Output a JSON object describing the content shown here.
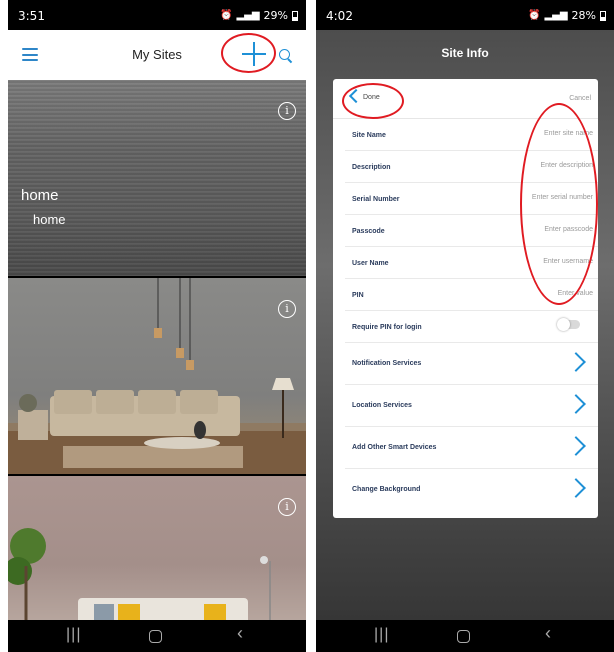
{
  "left": {
    "status": {
      "time": "3:51",
      "battery": "29%"
    },
    "app_bar": {
      "title": "My Sites"
    },
    "sites": [
      {
        "name": "home",
        "description": "home"
      },
      {
        "name": "",
        "description": ""
      },
      {
        "name": "",
        "description": ""
      }
    ],
    "info_glyph": "i"
  },
  "right": {
    "status": {
      "time": "4:02",
      "battery": "28%"
    },
    "screen_title": "Site Info",
    "done_label": "Done",
    "cancel_label": "Cancel",
    "fields": [
      {
        "label": "Site Name",
        "placeholder": "Enter site name"
      },
      {
        "label": "Description",
        "placeholder": "Enter description"
      },
      {
        "label": "Serial Number",
        "placeholder": "Enter serial number"
      },
      {
        "label": "Passcode",
        "placeholder": "Enter passcode"
      },
      {
        "label": "User Name",
        "placeholder": "Enter username"
      },
      {
        "label": "PIN",
        "placeholder": "Enter value"
      }
    ],
    "require_pin": {
      "label": "Require PIN for login",
      "enabled": false
    },
    "menu": [
      {
        "label": "Notification Services"
      },
      {
        "label": "Location Services"
      },
      {
        "label": "Add Other Smart Devices"
      },
      {
        "label": "Change Background"
      }
    ]
  },
  "system_icons": {
    "left_status": [
      "alarm-icon",
      "signal-icon",
      "battery-icon"
    ],
    "nav": [
      "recent-apps-icon",
      "home-icon",
      "back-icon"
    ]
  },
  "colors": {
    "accent": "#1e90d6",
    "annotation": "#e01b22",
    "label_text": "#2a3b5c"
  }
}
